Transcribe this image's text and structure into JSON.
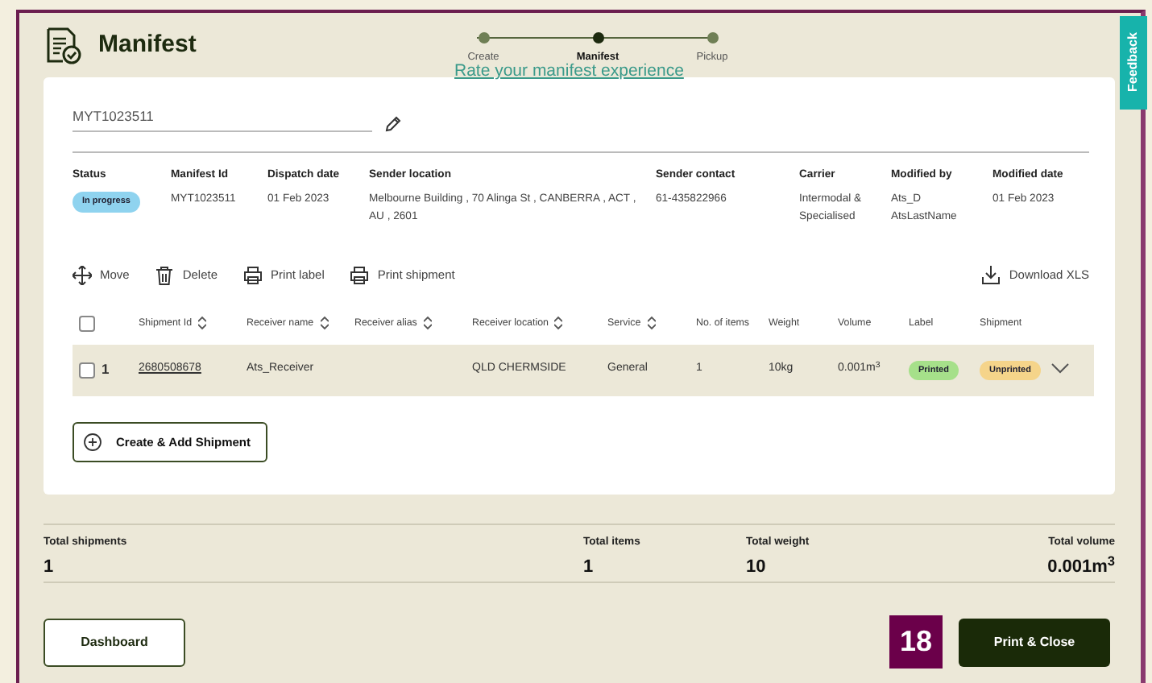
{
  "header": {
    "title": "Manifest",
    "feedback": "Feedback",
    "rate_link": "Rate your manifest experience"
  },
  "steps": [
    {
      "label": "Create",
      "selected": false
    },
    {
      "label": "Manifest",
      "selected": true
    },
    {
      "label": "Pickup",
      "selected": false
    }
  ],
  "manifest_field": {
    "value": "MYT1023511"
  },
  "details": [
    {
      "label": "Status",
      "value": "In progress",
      "kind": "badge"
    },
    {
      "label": "Manifest Id",
      "value": "MYT1023511",
      "kind": "text"
    },
    {
      "label": "Dispatch date",
      "value": "01 Feb 2023",
      "kind": "text"
    },
    {
      "label": "Sender location",
      "value": "Melbourne Building , 70 Alinga St , CANBERRA , ACT , AU , 2601",
      "kind": "text"
    },
    {
      "label": "Sender contact",
      "value": "61-435822966",
      "kind": "text"
    },
    {
      "label": "Carrier",
      "value": "Intermodal & Specialised",
      "kind": "text"
    },
    {
      "label": "Modified by",
      "value": "Ats_D AtsLastName",
      "kind": "text"
    },
    {
      "label": "Modified date",
      "value": "01 Feb 2023",
      "kind": "text"
    }
  ],
  "toolbar": [
    {
      "label": "Move",
      "kind": "move"
    },
    {
      "label": "Delete",
      "kind": "delete"
    },
    {
      "label": "Print label",
      "kind": "print"
    },
    {
      "label": "Print shipment",
      "kind": "print"
    },
    {
      "label": "Download XLS",
      "kind": "download"
    }
  ],
  "table": {
    "columns": [
      {
        "label": "Shipment Id",
        "sortable": true
      },
      {
        "label": "Receiver name",
        "sortable": true
      },
      {
        "label": "Receiver alias",
        "sortable": true
      },
      {
        "label": "Receiver location",
        "sortable": true
      },
      {
        "label": "Service",
        "sortable": true
      },
      {
        "label": "No. of items",
        "sortable": false
      },
      {
        "label": "Weight",
        "sortable": false
      },
      {
        "label": "Volume",
        "sortable": false
      },
      {
        "label": "Label",
        "sortable": false
      },
      {
        "label": "Shipment",
        "sortable": false
      }
    ],
    "header_checked": false,
    "rows": [
      {
        "checked": false,
        "index": "1",
        "shipment_id": "2680508678",
        "receiver_name": "Ats_Receiver",
        "receiver_alias": "",
        "receiver_location": "QLD CHERMSIDE",
        "service": "General",
        "items": "1",
        "weight": "10kg",
        "volume": "0.001m$^{3}$",
        "label_status": {
          "text": "Printed",
          "color": "#a6e08a"
        },
        "shipment_status": {
          "text": "Unprinted",
          "color": "#f5d48a"
        },
        "expanded": false
      }
    ]
  },
  "create_button": "Create & Add Shipment",
  "totals": [
    {
      "label": "Total shipments",
      "value": "1"
    },
    {
      "label": "Total items",
      "value": "1"
    },
    {
      "label": "Total weight",
      "value": "10"
    },
    {
      "label": "Total volume",
      "value": "0.001m$^{3}$"
    }
  ],
  "footer": {
    "dashboard_button": "Dashboard",
    "count_badge": "18",
    "print_close_button": "Print & Close"
  }
}
